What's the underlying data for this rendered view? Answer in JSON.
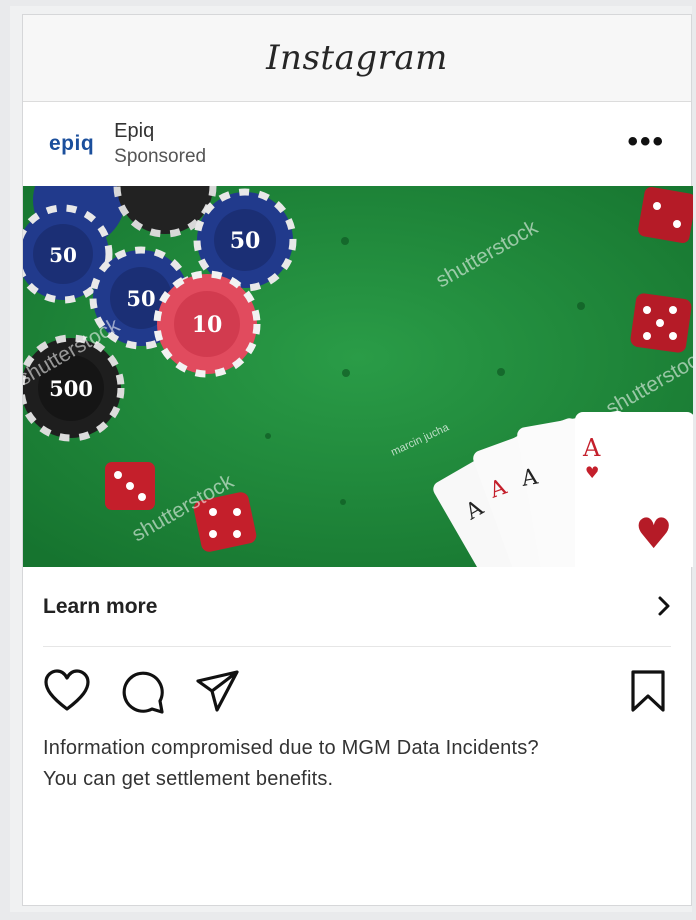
{
  "app": {
    "title": "Instagram"
  },
  "post": {
    "account_logo": "epiq",
    "account_name": "Epiq",
    "sponsored_label": "Sponsored",
    "more_label": "•••",
    "image": {
      "watermarks": [
        "shutterstock",
        "shutterstock",
        "shutterstock",
        "shutterstock"
      ],
      "contributor": "marcin jucha",
      "chips": [
        "50",
        "50",
        "50",
        "10",
        "500"
      ]
    },
    "cta_label": "Learn more",
    "caption_line1": "Information compromised due to MGM Data Incidents?",
    "caption_line2": "You can get settlement benefits."
  },
  "icons": [
    "heart-icon",
    "comment-icon",
    "share-icon",
    "bookmark-icon",
    "chevron-right-icon",
    "more-icon"
  ],
  "colors": {
    "felt_green": "#1f8a3a",
    "brand_blue": "#1b4f9c"
  }
}
